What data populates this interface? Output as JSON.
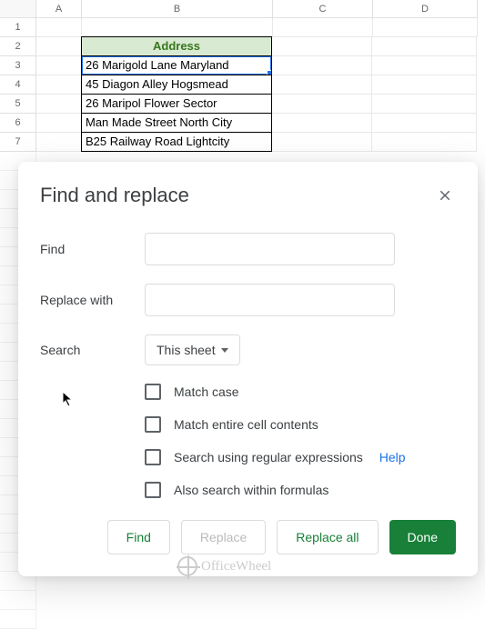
{
  "columns": [
    "A",
    "B",
    "C",
    "D"
  ],
  "rows": {
    "r1": "1",
    "r2": "2",
    "r3": "3",
    "r4": "4",
    "r5": "5",
    "r6": "6",
    "r7": "7"
  },
  "table": {
    "header": "Address",
    "cells": [
      "26 Marigold Lane Maryland",
      "45 Diagon Alley Hogsmead",
      "26 Maripol Flower Sector",
      "Man Made Street North City",
      "B25 Railway Road Lightcity"
    ]
  },
  "dialog": {
    "title": "Find and replace",
    "find_label": "Find",
    "replace_label": "Replace with",
    "search_label": "Search",
    "search_value": "This sheet",
    "checkboxes": {
      "match_case": "Match case",
      "entire_cell": "Match entire cell contents",
      "regex": "Search using regular expressions",
      "formulas": "Also search within formulas"
    },
    "help": "Help",
    "buttons": {
      "find": "Find",
      "replace": "Replace",
      "replace_all": "Replace all",
      "done": "Done"
    }
  },
  "watermark": "OfficeWheel"
}
